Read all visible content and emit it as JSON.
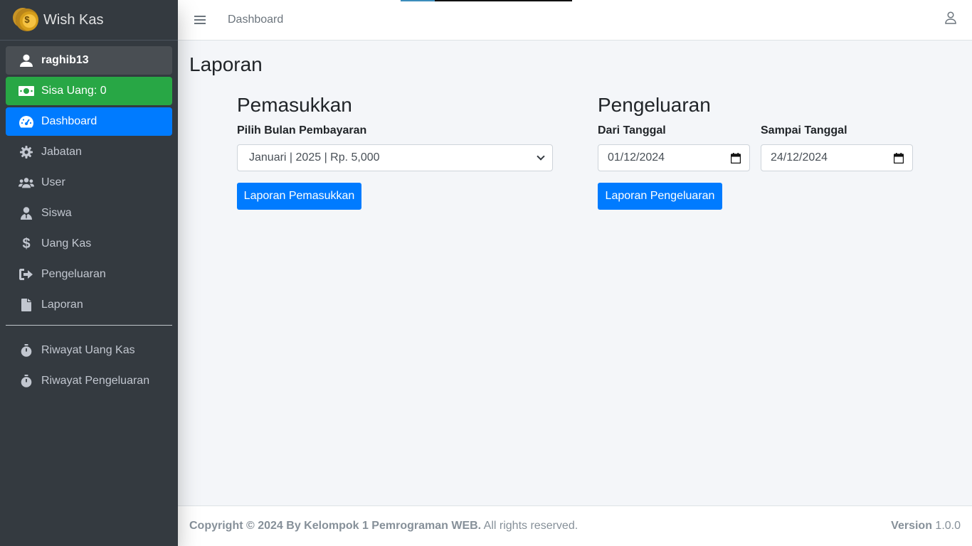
{
  "brand": {
    "name": "Wish Kas"
  },
  "sidebar": {
    "user": {
      "name": "raghib13",
      "icon": "user-icon"
    },
    "balance": {
      "label": "Sisa Uang: 0",
      "icon": "money-bill-icon"
    },
    "items": [
      {
        "label": "Dashboard",
        "icon": "tachometer-icon",
        "active": true
      },
      {
        "label": "Jabatan",
        "icon": "gear-icon"
      },
      {
        "label": "User",
        "icon": "users-icon"
      },
      {
        "label": "Siswa",
        "icon": "user-tie-icon"
      },
      {
        "label": "Uang Kas",
        "icon": "dollar-icon"
      },
      {
        "label": "Pengeluaran",
        "icon": "sign-out-icon"
      },
      {
        "label": "Laporan",
        "icon": "file-icon"
      }
    ],
    "history": [
      {
        "label": "Riwayat Uang Kas",
        "icon": "stopwatch-icon"
      },
      {
        "label": "Riwayat Pengeluaran",
        "icon": "stopwatch-icon"
      }
    ]
  },
  "header": {
    "link": "Dashboard"
  },
  "page": {
    "title": "Laporan"
  },
  "income": {
    "title": "Pemasukkan",
    "select_label": "Pilih Bulan Pembayaran",
    "selected": "Januari | 2025 | Rp. 5,000",
    "button": "Laporan Pemasukkan"
  },
  "expense": {
    "title": "Pengeluaran",
    "from_label": "Dari Tanggal",
    "from_value": "01/12/2024",
    "to_label": "Sampai Tanggal",
    "to_value": "24/12/2024",
    "button": "Laporan Pengeluaran"
  },
  "footer": {
    "copyright_bold": "Copyright © 2024 By Kelompok 1 Pemrograman WEB.",
    "copyright_rest": " All rights reserved.",
    "version_label": "Version",
    "version_value": " 1.0.0"
  },
  "colors": {
    "sidebar": "#343a40",
    "primary": "#007bff",
    "success": "#28a745",
    "background": "#f4f6f9"
  }
}
